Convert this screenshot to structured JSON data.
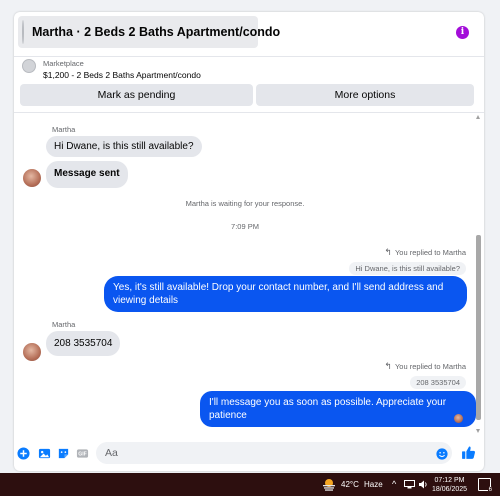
{
  "header": {
    "title": "Martha · 2 Beds 2 Baths Apartment/condo",
    "info_icon": "info-icon",
    "info_color": "#a30dd9"
  },
  "listing": {
    "source": "Marketplace",
    "price_title": "$1,200 - 2 Beds 2 Baths Apartment/condo",
    "mark_pending_label": "Mark as pending",
    "more_options_label": "More options"
  },
  "thread": {
    "msg1_sender": "Martha",
    "msg1_text": "Hi Dwane, is this still available?",
    "msg2_text": "Message sent",
    "waiting_text": "Martha is waiting for your response.",
    "timestamp": "7:09 PM",
    "reply1_meta": "You replied to Martha",
    "reply1_quote": "Hi Dwane, is this still available?",
    "reply1_text": "Yes, it's still available! Drop your contact number, and I'll send address and viewing details",
    "msg3_sender": "Martha",
    "msg3_text": "208 3535704",
    "reply2_meta": "You replied to Martha",
    "reply2_quote": "208 3535704",
    "reply2_text": "I'll message you as soon as possible. Appreciate your patience"
  },
  "composer": {
    "placeholder": "Aa",
    "icons": [
      "plus-circle-icon",
      "image-icon",
      "sticker-icon",
      "gif-icon",
      "emoji-icon",
      "thumbs-up-icon"
    ]
  },
  "colors": {
    "accent": "#0a7cff",
    "outgoing_bubble": "#0a56f0",
    "taskbar": "#2d0f0f"
  },
  "taskbar": {
    "temperature": "42°C",
    "weather": "Haze",
    "time": "07:12 PM",
    "date": "18/06/2025",
    "notifications": "6"
  }
}
